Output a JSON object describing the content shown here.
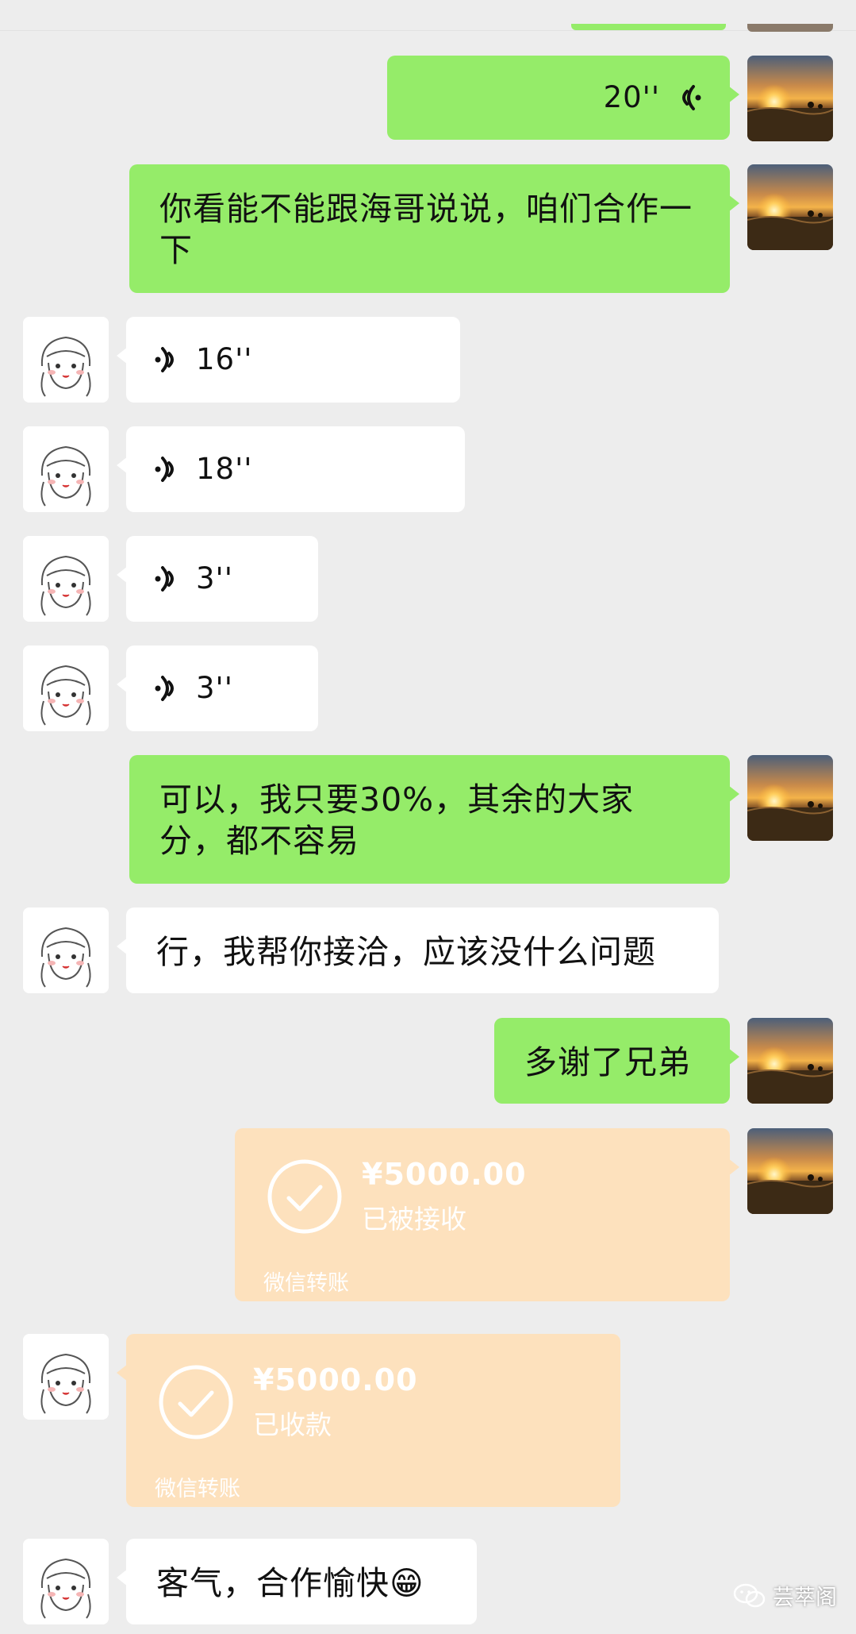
{
  "messages": {
    "voice_out_20": {
      "duration": "20''"
    },
    "text_out_1": {
      "text": "你看能不能跟海哥说说，咱们合作一下"
    },
    "voice_in_16": {
      "duration": "16''"
    },
    "voice_in_18": {
      "duration": "18''"
    },
    "voice_in_3a": {
      "duration": "3''"
    },
    "voice_in_3b": {
      "duration": "3''"
    },
    "text_out_2": {
      "text": "可以，我只要30%，其余的大家分，都不容易"
    },
    "text_in_1": {
      "text": "行，我帮你接洽，应该没什么问题"
    },
    "text_out_3": {
      "text": "多谢了兄弟"
    },
    "transfer_out": {
      "amount": "¥5000.00",
      "status": "已被接收",
      "brand": "微信转账"
    },
    "transfer_in": {
      "amount": "¥5000.00",
      "status": "已收款",
      "brand": "微信转账"
    },
    "text_in_2": {
      "text": "客气，合作愉快😁"
    }
  },
  "watermark": {
    "label": "芸萃阁"
  },
  "colors": {
    "background": "#ededed",
    "outgoing_bubble": "#95ec69",
    "incoming_bubble": "#ffffff",
    "transfer_card": "#fde1bd"
  }
}
